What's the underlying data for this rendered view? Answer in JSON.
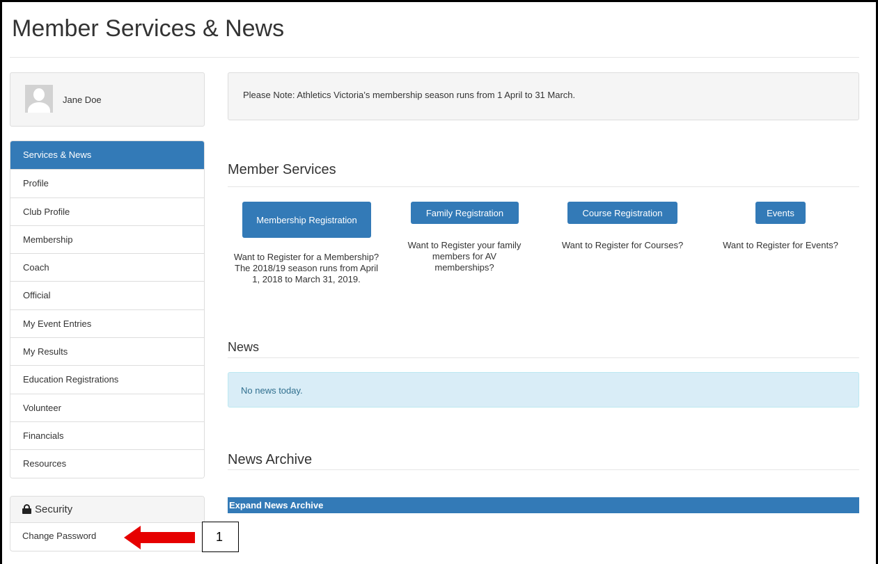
{
  "page": {
    "title": "Member Services & News"
  },
  "user": {
    "name": "Jane Doe"
  },
  "sidebar": {
    "items": [
      {
        "label": "Services & News"
      },
      {
        "label": "Profile"
      },
      {
        "label": "Club Profile"
      },
      {
        "label": "Membership"
      },
      {
        "label": "Coach"
      },
      {
        "label": "Official"
      },
      {
        "label": "My Event Entries"
      },
      {
        "label": "My Results"
      },
      {
        "label": "Education Registrations"
      },
      {
        "label": "Volunteer"
      },
      {
        "label": "Financials"
      },
      {
        "label": "Resources"
      }
    ],
    "active_index": 0
  },
  "security": {
    "title": "Security",
    "change_password": "Change Password"
  },
  "note": "Please Note: Athletics Victoria’s membership season runs from 1 April to 31 March.",
  "member_services": {
    "title": "Member Services",
    "items": [
      {
        "button": "Membership Registration",
        "description": "Want to Register for a Membership? The 2018/19 season runs from April 1, 2018 to March 31, 2019."
      },
      {
        "button": "Family Registration",
        "description": "Want to Register your family members for AV memberships?"
      },
      {
        "button": "Course Registration",
        "description": "Want to Register for Courses?"
      },
      {
        "button": "Events",
        "description": "Want to Register for Events?"
      }
    ]
  },
  "news": {
    "title": "News",
    "empty_message": "No news today."
  },
  "news_archive": {
    "title": "News Archive",
    "expand_label": "Expand News Archive"
  },
  "annotation": {
    "callout_number": "1"
  },
  "colors": {
    "primary": "#337ab7",
    "info_bg": "#d9edf7",
    "arrow": "#e60000"
  }
}
